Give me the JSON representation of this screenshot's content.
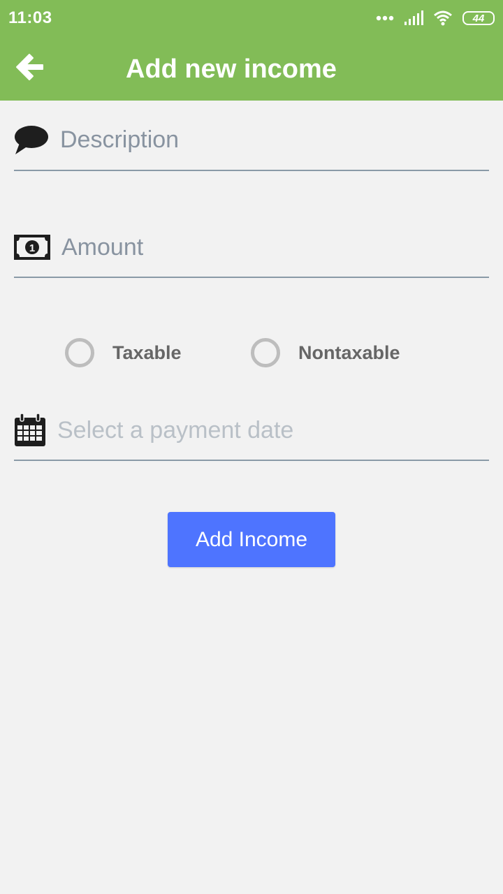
{
  "status_bar": {
    "time": "11:03",
    "battery": "44",
    "icons": [
      "dots-icon",
      "signal-icon",
      "wifi-icon",
      "battery-icon"
    ]
  },
  "header": {
    "title": "Add new income",
    "back_icon": "arrow-left-icon"
  },
  "form": {
    "description": {
      "placeholder": "Description",
      "value": "",
      "icon": "speech-bubble-icon"
    },
    "amount": {
      "placeholder": "Amount",
      "value": "",
      "icon": "banknote-icon"
    },
    "tax_options": [
      {
        "label": "Taxable",
        "selected": false
      },
      {
        "label": "Nontaxable",
        "selected": false
      }
    ],
    "payment_date": {
      "placeholder": "Select a payment date",
      "value": "",
      "icon": "calendar-icon"
    },
    "submit_label": "Add Income"
  },
  "colors": {
    "header": "#82bc57",
    "background": "#f2f2f2",
    "button": "#4e74ff",
    "underline": "#8a9aa7"
  }
}
